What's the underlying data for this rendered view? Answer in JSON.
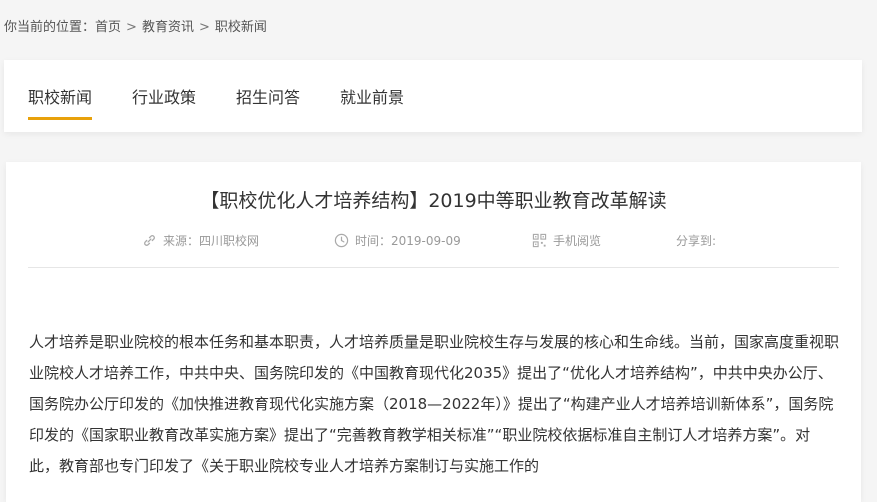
{
  "breadcrumb": {
    "prefix": "你当前的位置：",
    "items": [
      "首页",
      "教育资讯",
      "职校新闻"
    ],
    "separator": ">"
  },
  "tabs": [
    {
      "label": "职校新闻",
      "active": true
    },
    {
      "label": "行业政策",
      "active": false
    },
    {
      "label": "招生问答",
      "active": false
    },
    {
      "label": "就业前景",
      "active": false
    }
  ],
  "colors": {
    "accent": "#e8a10a"
  },
  "article": {
    "title": "【职校优化人才培养结构】2019中等职业教育改革解读",
    "meta": {
      "source": "来源：四川职校网",
      "time": "时间：2019-09-09",
      "mobile": "手机阅览",
      "share": "分享到:"
    },
    "paragraph": "人才培养是职业院校的根本任务和基本职责，人才培养质量是职业院校生存与发展的核心和生命线。当前，国家高度重视职业院校人才培养工作，中共中央、国务院印发的《中国教育现代化2035》提出了“优化人才培养结构”，中共中央办公厅、国务院办公厅印发的《加快推进教育现代化实施方案（2018—2022年）》提出了“构建产业人才培养培训新体系”，国务院印发的《国家职业教育改革实施方案》提出了“完善教育教学相关标准”“职业院校依据标准自主制订人才培养方案”。对此，教育部也专门印发了《关于职业院校专业人才培养方案制订与实施工作的"
  },
  "icons": {
    "source": "link-icon",
    "time": "clock-icon",
    "mobile": "qrcode-icon"
  }
}
